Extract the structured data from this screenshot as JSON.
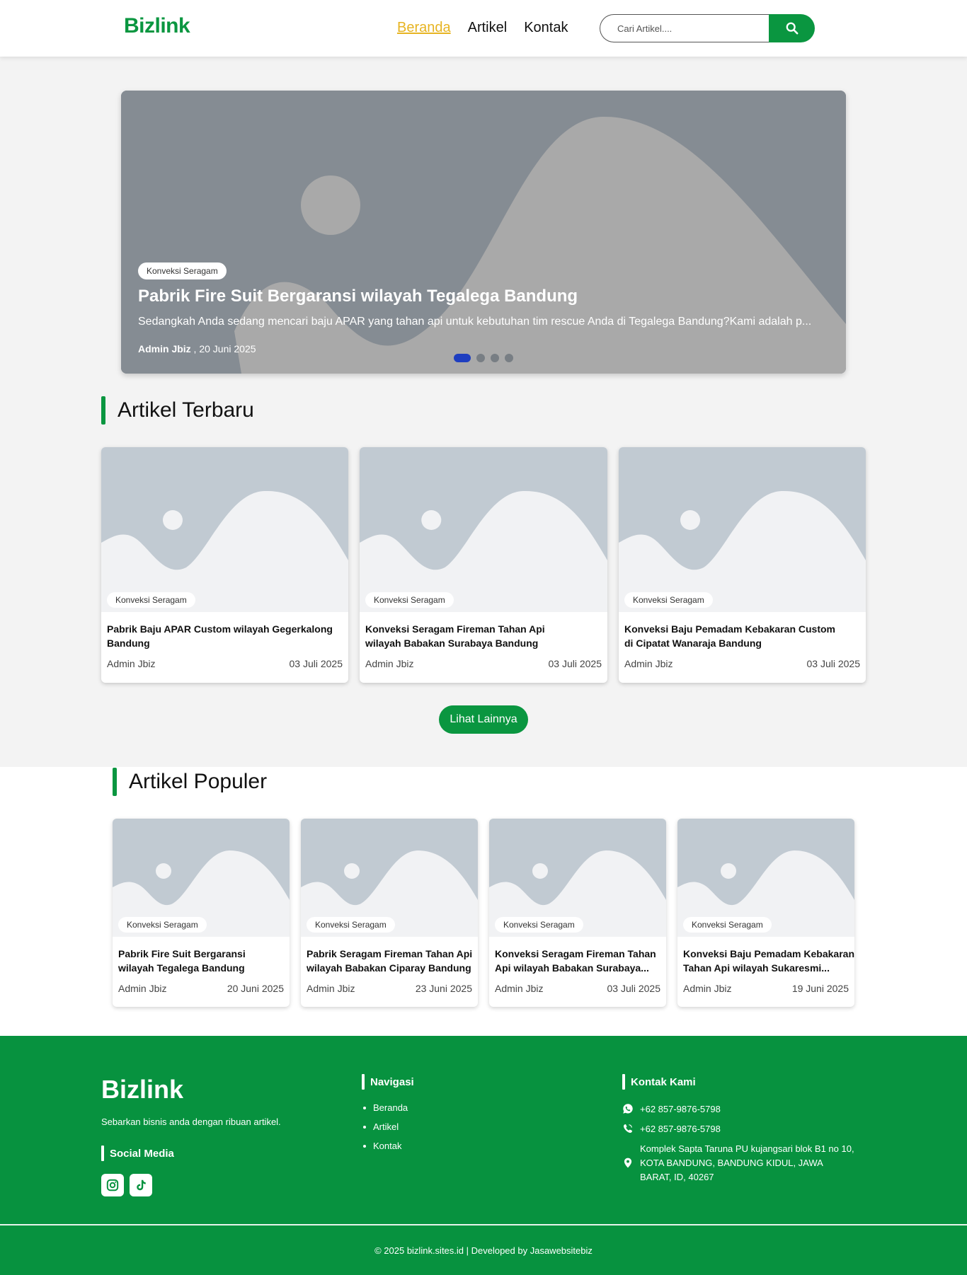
{
  "header": {
    "logo": "Bizlink",
    "nav": [
      "Beranda",
      "Artikel",
      "Kontak"
    ],
    "search_placeholder": "Cari Artikel....",
    "search_icon": "search-icon"
  },
  "hero": {
    "category": "Konveksi Seragam",
    "title": "Pabrik Fire Suit Bergaransi wilayah Tegalega Bandung",
    "description": "Sedangkah Anda sedang mencari baju APAR yang tahan api untuk kebutuhan tim rescue Anda di Tegalega Bandung?Kami adalah p...",
    "author": "Admin Jbiz",
    "date": " , 20 Juni 2025",
    "slide_count": 4,
    "active_slide": 0
  },
  "latest": {
    "heading": "Artikel Terbaru",
    "cards": [
      {
        "category": "Konveksi Seragam",
        "title_line1": "Pabrik Baju APAR Custom wilayah Gegerkalong",
        "title_line2": "Bandung",
        "author": "Admin Jbiz",
        "date": "03 Juli 2025"
      },
      {
        "category": "Konveksi Seragam",
        "title_line1": "Konveksi Seragam Fireman Tahan Api",
        "title_line2": "wilayah Babakan Surabaya Bandung",
        "author": "Admin Jbiz",
        "date": "03 Juli 2025"
      },
      {
        "category": "Konveksi Seragam",
        "title_line1": "Konveksi Baju Pemadam Kebakaran Custom",
        "title_line2": "di Cipatat Wanaraja Bandung",
        "author": "Admin Jbiz",
        "date": "03 Juli 2025"
      }
    ],
    "more_label": "Lihat Lainnya"
  },
  "popular": {
    "heading": "Artikel Populer",
    "cards": [
      {
        "category": "Konveksi Seragam",
        "title_line1": "Pabrik Fire Suit Bergaransi",
        "title_line2": "wilayah Tegalega Bandung",
        "author": "Admin Jbiz",
        "date": "20 Juni 2025"
      },
      {
        "category": "Konveksi Seragam",
        "title_line1": "Pabrik Seragam Fireman Tahan Api",
        "title_line2": "wilayah Babakan Ciparay Bandung",
        "author": "Admin Jbiz",
        "date": "23 Juni 2025"
      },
      {
        "category": "Konveksi Seragam",
        "title_line1": "Konveksi Seragam Fireman Tahan",
        "title_line2": "Api wilayah Babakan Surabaya...",
        "author": "Admin Jbiz",
        "date": "03 Juli 2025"
      },
      {
        "category": "Konveksi Seragam",
        "title_line1": "Konveksi Baju Pemadam Kebakaran",
        "title_line2": "Tahan Api wilayah Sukaresmi...",
        "author": "Admin Jbiz",
        "date": "19 Juni 2025"
      }
    ]
  },
  "footer": {
    "logo": "Bizlink",
    "tagline": "Sebarkan bisnis anda dengan ribuan artikel.",
    "social_heading": "Social Media",
    "social_icons": [
      "instagram-icon",
      "tiktok-icon"
    ],
    "nav_heading": "Navigasi",
    "nav": [
      "Beranda",
      "Artikel",
      "Kontak"
    ],
    "contact_heading": "Kontak Kami",
    "whatsapp": "+62 857-9876-5798",
    "phone": "+62 857-9876-5798",
    "address_line1": "Komplek Sapta Taruna PU kujangsari blok B1 no 10,",
    "address_line2": "KOTA BANDUNG, BANDUNG KIDUL, JAWA",
    "address_line3": "BARAT, ID, 40267",
    "copyright": "© 2025 bizlink.sites.id | Developed by Jasawebsitebiz"
  },
  "colors": {
    "brand_green": "#0a9640",
    "nav_active": "#e7b422",
    "slider_active_dot": "#1e3ec0",
    "footer_bg": "#07923f"
  }
}
